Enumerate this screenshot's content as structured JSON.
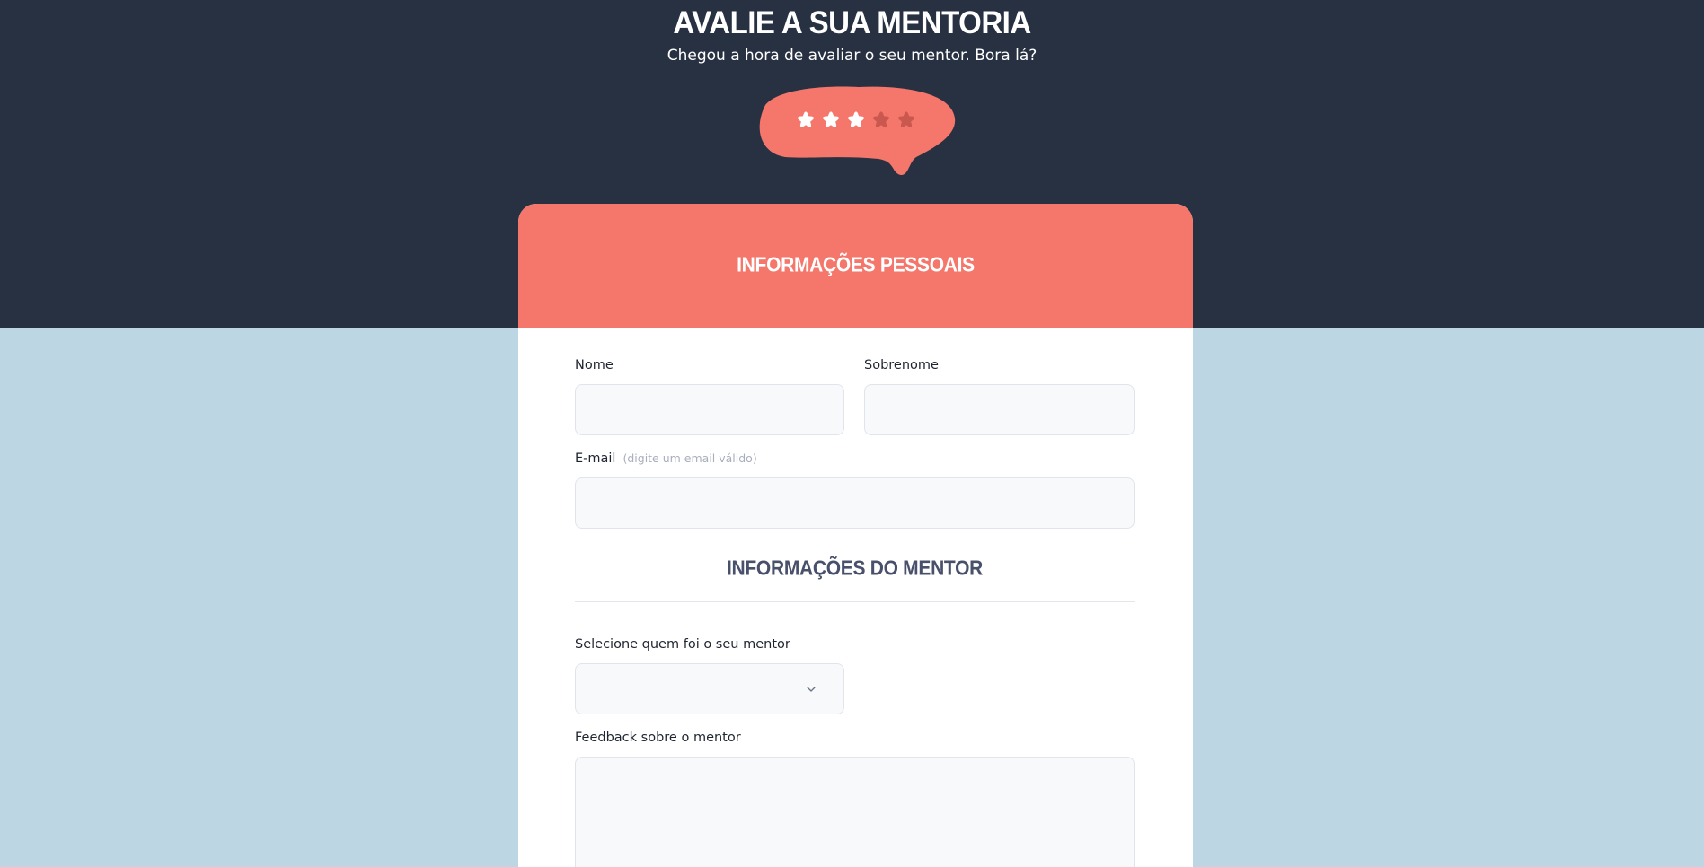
{
  "header": {
    "title": "AVALIE A SUA MENTORIA",
    "subtitle": "Chegou a hora de avaliar o seu mentor. Bora lá?"
  },
  "rating": {
    "value": 3,
    "max": 5,
    "bubble_color": "#f5766a",
    "star_filled_color": "#ffffff",
    "star_empty_color": "#c9584f",
    "icon": "star-icon"
  },
  "card": {
    "header_title": "INFORMAÇÕES PESSOAIS",
    "header_color": "#f5766a"
  },
  "form": {
    "first_name": {
      "label": "Nome",
      "value": ""
    },
    "last_name": {
      "label": "Sobrenome",
      "value": ""
    },
    "email": {
      "label": "E-mail",
      "hint": "(digite um email válido)",
      "value": ""
    },
    "mentor_section_title": "INFORMAÇÕES DO MENTOR",
    "mentor_select": {
      "label": "Selecione quem foi o seu mentor",
      "selected": "",
      "icon": "chevron-down-icon"
    },
    "feedback": {
      "label": "Feedback sobre o mentor",
      "value": ""
    }
  },
  "colors": {
    "top_band": "#283142",
    "page_background": "#bdd6e3",
    "accent": "#f5766a",
    "section_title": "#48506b"
  }
}
